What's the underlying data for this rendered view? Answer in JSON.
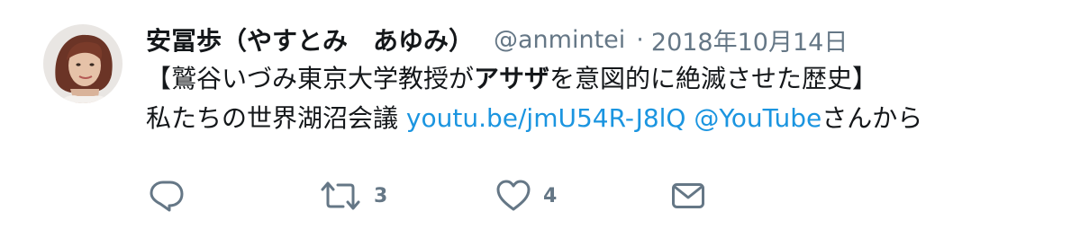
{
  "tweet": {
    "author_name": "安冨歩（やすとみ　あゆみ）",
    "handle": "@anmintei",
    "separator": "·",
    "date": "2018年10月14日",
    "text": {
      "line1_pre": "【鷲谷いづみ東京大学教授が",
      "line1_bold": "アサザ",
      "line1_post": "を意図的に絶滅させた歴史】",
      "line2_pre": "私たちの世界湖沼会議 ",
      "link_url": "youtu.be/jmU54R-J8lQ",
      "space": " ",
      "mention": "@YouTube",
      "line2_post": "さんから"
    }
  },
  "actions": {
    "reply": {
      "icon": "reply-icon",
      "count": ""
    },
    "retweet": {
      "icon": "retweet-icon",
      "count": "3"
    },
    "like": {
      "icon": "heart-icon",
      "count": "4"
    },
    "dm": {
      "icon": "envelope-icon",
      "count": ""
    }
  },
  "colors": {
    "text": "#14171a",
    "secondary": "#657786",
    "link": "#1b95e0",
    "icon": "#657786"
  }
}
